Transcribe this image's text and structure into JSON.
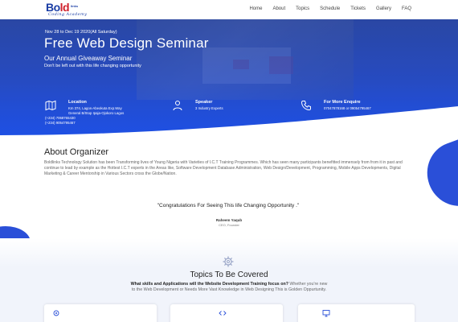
{
  "header": {
    "logo": {
      "main": "Boldlinks",
      "small": "links",
      "sub": "Coding Academy"
    },
    "nav": [
      "Home",
      "About",
      "Topics",
      "Schedule",
      "Tickets",
      "Gallery",
      "FAQ"
    ]
  },
  "hero": {
    "dates": "Nov 28 to Dec 19 2020(All Saturday)",
    "title": "Free Web Design Seminar",
    "subtitle": "Our Annual Giveaway Seminar",
    "tagline": "Don't be left out with this life changing opportunity",
    "location": {
      "label": "Location",
      "line1": "Km 374, Lagos-Abeokuta Exp.Way",
      "line2": "General B/Stop Ipaja-Ojokoro Lagos",
      "phone1": "(+234) 7068765430",
      "phone2": "(+234) 9054795467"
    },
    "speaker": {
      "label": "Speaker",
      "text": "3 Industry Experts"
    },
    "enquire": {
      "label": "For More Enquire",
      "text": "07047878168 or 09054795467"
    }
  },
  "about": {
    "title": "About Organizer",
    "text": "Boldlinks Technology Solution has been Transforming lives of Young Nigeria with Varieties of I.C.T Training Programmes. Which has seen many participants benefitted immensely from from it in past and continue to lead by example as the Hottest I.C.T experts in the Areas like, Software Development Database Administration, Web Design/Development, Programming, Mobile Apps Developments, Digital Marketing & Career Mentorship in Various Sectors cross the Globe/Nation.",
    "quote": "\"Congratulations For Seeing This life Changing Opportunity .\"",
    "quote_author": "Raheem Yaqub",
    "quote_role": "CEO, Founder"
  },
  "topics": {
    "title": "Topics To Be Covered",
    "desc_strong": "What skills and Applications will the Website Development Training focus on?",
    "desc_rest": " Whether you're new to the Web Development or Needs More Vast Knowledge in Web Designing This is Golden Oppurtunity."
  },
  "colors": {
    "brand_blue": "#2a4fd8",
    "brand_red": "#d0202b",
    "hero_top": "#2e4fa8",
    "hero_bottom": "#2050d8"
  },
  "icons": {
    "location": "map-icon",
    "speaker": "speaker-icon",
    "enquire": "phone-icon",
    "topics": "gear-icon"
  }
}
